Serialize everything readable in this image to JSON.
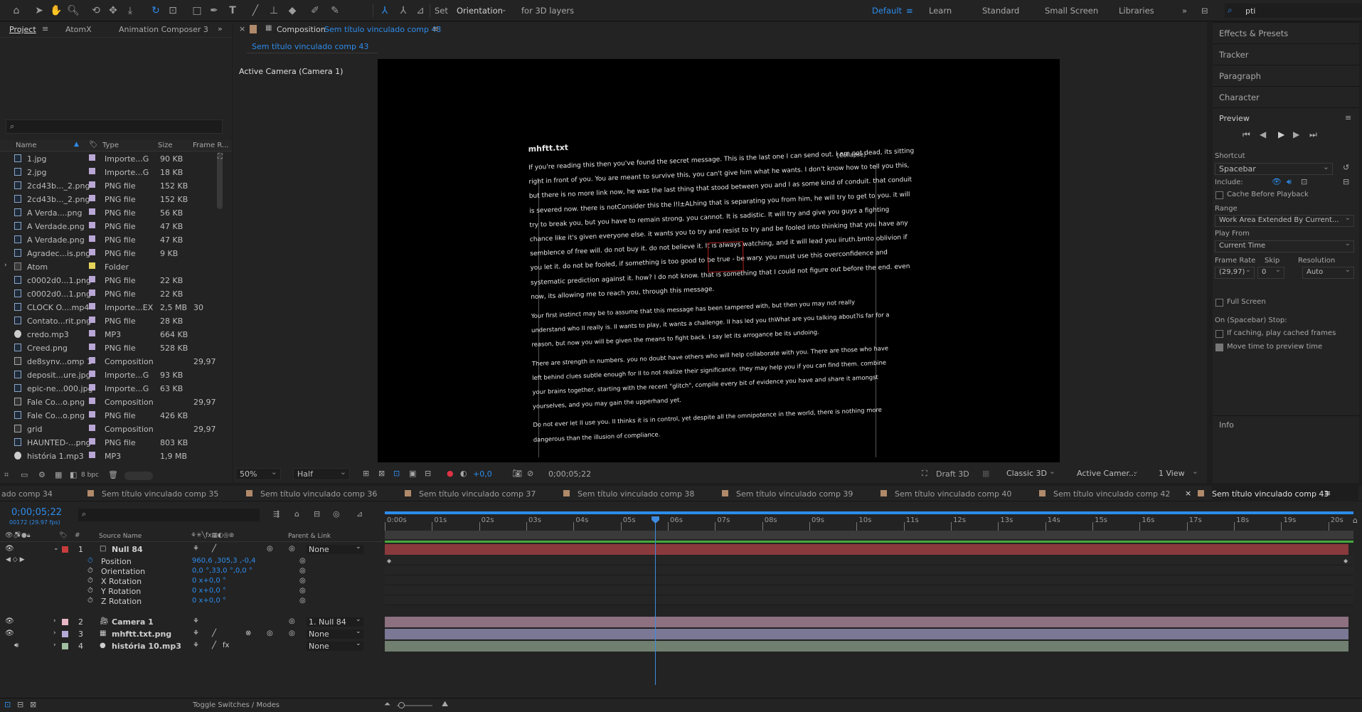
{
  "toolbar": {
    "set_label": "Set",
    "orientation": "Orientation",
    "for_3d": "for 3D layers",
    "workspaces": [
      "Default",
      "Learn",
      "Standard",
      "Small Screen",
      "Libraries"
    ],
    "search_value": "pti"
  },
  "project": {
    "tabs": [
      "Project",
      "AtomX",
      "Animation Composer 3"
    ],
    "columns": [
      "Name",
      "Type",
      "Size",
      "Frame R..."
    ],
    "rows": [
      {
        "name": "1.jpg",
        "type": "Importe...G",
        "size": "90 KB",
        "fr": "",
        "color": "#b9a7d6",
        "kind": "file"
      },
      {
        "name": "2.jpg",
        "type": "Importe...G",
        "size": "18 KB",
        "fr": "",
        "color": "#b9a7d6",
        "kind": "file"
      },
      {
        "name": "2cd43b..._2.png",
        "type": "PNG file",
        "size": "152 KB",
        "fr": "",
        "color": "#b9a7d6",
        "kind": "file"
      },
      {
        "name": "2cd43b..._2.png",
        "type": "PNG file",
        "size": "152 KB",
        "fr": "",
        "color": "#b9a7d6",
        "kind": "file"
      },
      {
        "name": "A Verda....png",
        "type": "PNG file",
        "size": "56 KB",
        "fr": "",
        "color": "#b9a7d6",
        "kind": "file"
      },
      {
        "name": "A Verdade.png",
        "type": "PNG file",
        "size": "47 KB",
        "fr": "",
        "color": "#b9a7d6",
        "kind": "file"
      },
      {
        "name": "A Verdade.png",
        "type": "PNG file",
        "size": "47 KB",
        "fr": "",
        "color": "#b9a7d6",
        "kind": "file"
      },
      {
        "name": "Agradec...is.png",
        "type": "PNG file",
        "size": "9 KB",
        "fr": "",
        "color": "#b9a7d6",
        "kind": "file"
      },
      {
        "name": "Atom",
        "type": "Folder",
        "size": "",
        "fr": "",
        "color": "#e6d35a",
        "kind": "folder"
      },
      {
        "name": "c0002d0...1.png",
        "type": "PNG file",
        "size": "22 KB",
        "fr": "",
        "color": "#b9a7d6",
        "kind": "file"
      },
      {
        "name": "c0002d0...1.png",
        "type": "PNG file",
        "size": "22 KB",
        "fr": "",
        "color": "#b9a7d6",
        "kind": "file"
      },
      {
        "name": "CLOCK O....mp4",
        "type": "Importe...EX",
        "size": "2,5 MB",
        "fr": "30",
        "color": "#b9a7d6",
        "kind": "file"
      },
      {
        "name": "Contato...rit.png",
        "type": "PNG file",
        "size": "28 KB",
        "fr": "",
        "color": "#b9a7d6",
        "kind": "file"
      },
      {
        "name": "credo.mp3",
        "type": "MP3",
        "size": "664 KB",
        "fr": "",
        "color": "#b9a7d6",
        "kind": "audio"
      },
      {
        "name": "Creed.png",
        "type": "PNG file",
        "size": "528 KB",
        "fr": "",
        "color": "#b9a7d6",
        "kind": "file"
      },
      {
        "name": "de8synv...omp 1",
        "type": "Composition",
        "size": "",
        "fr": "29,97",
        "color": "#b9a7d6",
        "kind": "comp"
      },
      {
        "name": "deposit...ure.jpg",
        "type": "Importe...G",
        "size": "93 KB",
        "fr": "",
        "color": "#b9a7d6",
        "kind": "file"
      },
      {
        "name": "epic-ne...000.jpg",
        "type": "Importe...G",
        "size": "63 KB",
        "fr": "",
        "color": "#b9a7d6",
        "kind": "file"
      },
      {
        "name": "Fale Co...o.png",
        "type": "Composition",
        "size": "",
        "fr": "29,97",
        "color": "#b9a7d6",
        "kind": "comp"
      },
      {
        "name": "Fale Co...o.png",
        "type": "PNG file",
        "size": "426 KB",
        "fr": "",
        "color": "#b9a7d6",
        "kind": "file"
      },
      {
        "name": "grid",
        "type": "Composition",
        "size": "",
        "fr": "29,97",
        "color": "#b9a7d6",
        "kind": "comp"
      },
      {
        "name": "HAUNTED-...png",
        "type": "PNG file",
        "size": "803 KB",
        "fr": "",
        "color": "#b9a7d6",
        "kind": "file"
      },
      {
        "name": "história 1.mp3",
        "type": "MP3",
        "size": "1,9 MB",
        "fr": "",
        "color": "#b9a7d6",
        "kind": "audio"
      }
    ],
    "bpc": "8 bpc"
  },
  "comp": {
    "title_prefix": "Composition",
    "title_name": "Sem título vinculado comp 43",
    "subtab": "Sem título vinculado comp 43",
    "active_camera": "Active Camera (Camera 1)",
    "zoom": "50%",
    "resolution": "Half",
    "exposure": "+0,0",
    "timecode": "0;00;05;22",
    "draft3d": "Draft 3D",
    "renderer": "Classic 3D",
    "camera_view": "Active Camer...",
    "views": "1 View",
    "doc": {
      "filename": "mhftt.txt",
      "collapse": "[Collapse]",
      "lines": [
        "If you're reading this then you've found the secret message. This is the last one I can send out. I am not dead, its sitting",
        "right in front of you. You are meant to survive this, you can't give him what he wants. I don't know how to tell you this,",
        "but there is no more link now, he was the last thing that stood between you and I as some kind of conduit. that conduit",
        "is severed now. there is notConsider this the l!l±ALhing that is separating you from him, he will try to get to you. it will",
        "try to break you, but you have to remain strong, you cannot. It is sadistic. It will try and give you guys a fighting",
        "chance like it's given everyone else. it wants you to try and resist to try and be fooled into thinking that you have any",
        "semblence of free will. do not buy it. do not believe it. It is always watching, and it will lead you iiruth.bmto oblivion if",
        "you let it. do not be fooled, if something is too good to be true - be wary. you must use this overconfidence and",
        "systematic prediction against it. how? I do not know. that is something that I could not figure out before the end. even",
        "now, its allowing me to reach you, through this message.",
        "Your first instinct may be to assume that this message has been tampered with, but then you may not really",
        "understand who II really is. II wants to play, it wants a challenge. II has led you thWhat are you talking about?is far for a",
        "reason, but now you will be given the means to fight back. I say let its arrogance be its undoing.",
        "There are strength in numbers. you no doubt have others who will help collaborate with you. There are those who have",
        "left behind clues subtle enough for II to not realize their significance. they may help you if you can find them. combine",
        "your brains together, starting with the recent \"glitch\", compile every bit of evidence you have and share it amongst",
        "yourselves, and you may gain the upperhand yet.",
        "Do not ever let II use you. II thinks it is in control, yet despite all the omnipotence in the world, there is nothing more",
        "dangerous than the illusion of compliance."
      ]
    }
  },
  "right": {
    "effects": "Effects & Presets",
    "tracker": "Tracker",
    "paragraph": "Paragraph",
    "character": "Character",
    "preview": "Preview",
    "shortcut_label": "Shortcut",
    "shortcut": "Spacebar",
    "include": "Include:",
    "cache_before": "Cache Before Playback",
    "range_label": "Range",
    "range": "Work Area Extended By Current...",
    "play_from_label": "Play From",
    "play_from": "Current Time",
    "frame_rate_label": "Frame Rate",
    "skip_label": "Skip",
    "resolution_label": "Resolution",
    "frame_rate": "(29,97)",
    "skip": "0",
    "res": "Auto",
    "full_screen": "Full Screen",
    "stop_label": "On (Spacebar) Stop:",
    "if_caching": "If caching, play cached frames",
    "move_time": "Move time to preview time",
    "info": "Info"
  },
  "timeline": {
    "tabs": [
      "ado comp 34",
      "Sem título vinculado comp 35",
      "Sem título vinculado comp 36",
      "Sem título vinculado comp 37",
      "Sem título vinculado comp 38",
      "Sem título vinculado comp 39",
      "Sem título vinculado comp 40",
      "Sem título vinculado comp 42",
      "Sem título vinculado comp 43"
    ],
    "timecode": "0;00;05;22",
    "frames": "00172 (29.97 fps)",
    "source_name": "Source Name",
    "parent_link": "Parent & Link",
    "ruler": [
      "0:00s",
      "01s",
      "02s",
      "03s",
      "04s",
      "05s",
      "06s",
      "07s",
      "08s",
      "09s",
      "10s",
      "11s",
      "12s",
      "13s",
      "14s",
      "15s",
      "16s",
      "17s",
      "18s",
      "19s",
      "20s"
    ],
    "layers": [
      {
        "num": "1",
        "name": "Null 84",
        "parent": "None",
        "color": "#c83c3c"
      },
      {
        "num": "2",
        "name": "Camera 1",
        "parent": "1. Null 84",
        "color": "#e7b6c4"
      },
      {
        "num": "3",
        "name": "mhftt.txt.png",
        "parent": "None",
        "color": "#b4a9d8"
      },
      {
        "num": "4",
        "name": "história 10.mp3",
        "parent": "None",
        "color": "#9fc1a2"
      }
    ],
    "props": [
      {
        "name": "Position",
        "value": "960,6 ,305,3 ,-0,4"
      },
      {
        "name": "Orientation",
        "value": "0,0 °,33,0 °,0,0 °"
      },
      {
        "name": "X Rotation",
        "value": "0 x+0,0 °"
      },
      {
        "name": "Y Rotation",
        "value": "0 x+0,0 °"
      },
      {
        "name": "Z Rotation",
        "value": "0 x+0,0 °"
      }
    ],
    "toggle": "Toggle Switches / Modes",
    "playhead_seconds": 5.73
  }
}
